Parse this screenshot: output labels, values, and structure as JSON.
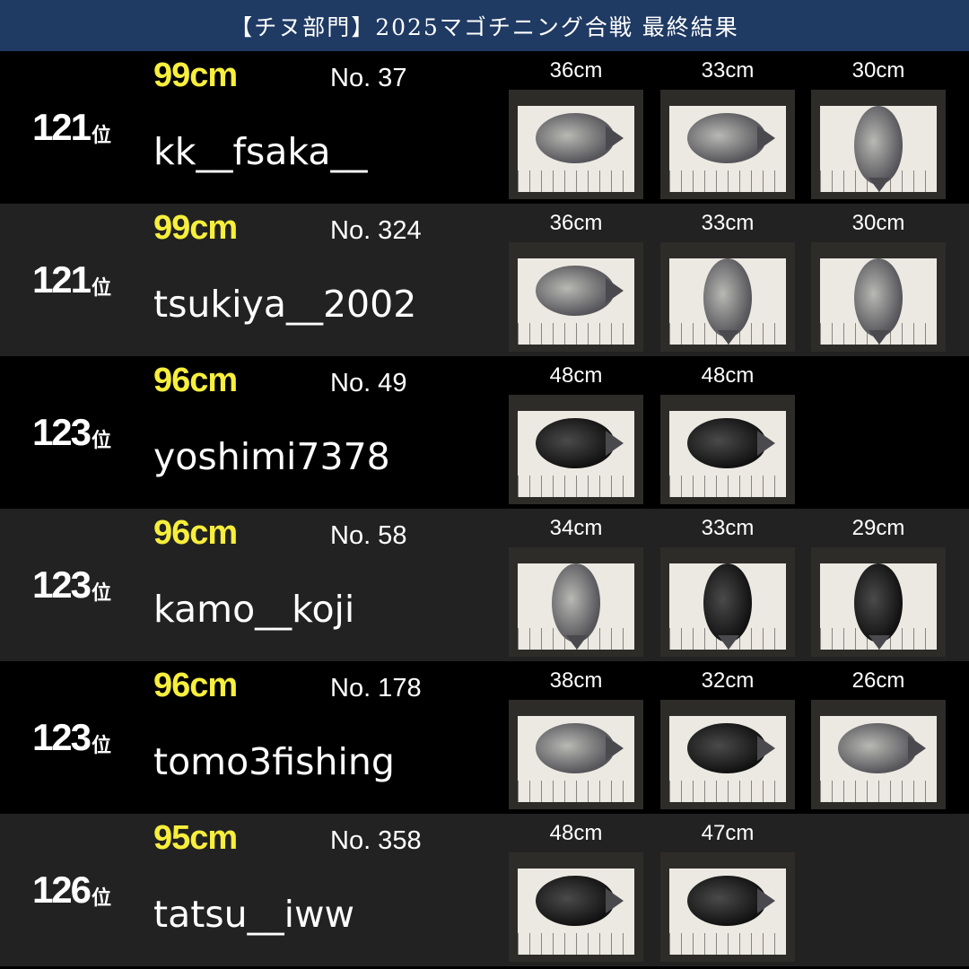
{
  "header": {
    "title": "【チヌ部門】2025マゴチニング合戦 最終結果"
  },
  "rank_suffix": "位",
  "entries": [
    {
      "rank": "121",
      "total": "99cm",
      "entry_no": "No. 37",
      "username": "kk__fsaka__",
      "catches": [
        "36cm",
        "33cm",
        "30cm"
      ]
    },
    {
      "rank": "121",
      "total": "99cm",
      "entry_no": "No. 324",
      "username": "tsukiya__2002",
      "catches": [
        "36cm",
        "33cm",
        "30cm"
      ]
    },
    {
      "rank": "123",
      "total": "96cm",
      "entry_no": "No. 49",
      "username": "yoshimi7378",
      "catches": [
        "48cm",
        "48cm"
      ]
    },
    {
      "rank": "123",
      "total": "96cm",
      "entry_no": "No. 58",
      "username": "kamo__koji",
      "catches": [
        "34cm",
        "33cm",
        "29cm"
      ]
    },
    {
      "rank": "123",
      "total": "96cm",
      "entry_no": "No. 178",
      "username": "tomo3fishing",
      "catches": [
        "38cm",
        "32cm",
        "26cm"
      ]
    },
    {
      "rank": "126",
      "total": "95cm",
      "entry_no": "No. 358",
      "username": "tatsu__iww",
      "catches": [
        "48cm",
        "47cm"
      ]
    }
  ],
  "colors": {
    "header_bg": "#1f3a63",
    "total_yellow": "#f7ef3b",
    "row_dark": "#000000",
    "row_light": "#222222"
  }
}
